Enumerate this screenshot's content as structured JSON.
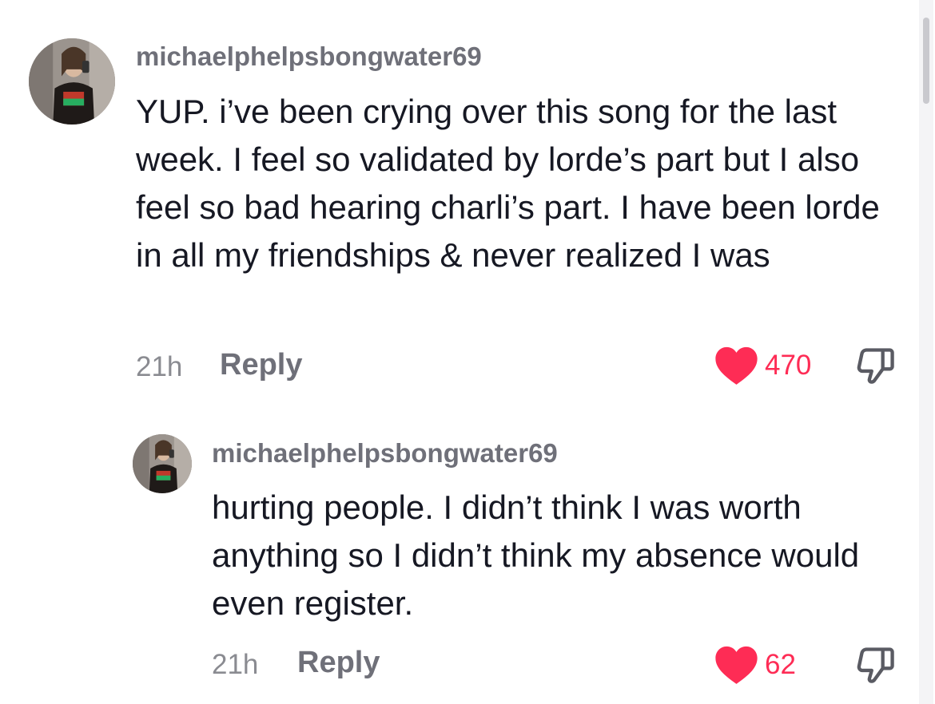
{
  "comments": [
    {
      "username": "michaelphelpsbongwater69",
      "text": "YUP. i’ve been crying over this song for the last week. I feel so validated by lorde’s part but I also feel so bad hearing charli’s part. I have been lorde in all my friendships & never realized I was",
      "time": "21h",
      "reply_label": "Reply",
      "likes": "470",
      "liked": true
    },
    {
      "username": "michaelphelpsbongwater69",
      "text": "hurting people. I didn’t think I was worth anything so I didn’t think my absence would even register.",
      "time": "21h",
      "reply_label": "Reply",
      "likes": "62",
      "liked": true
    }
  ],
  "colors": {
    "like_accent": "#fe2c55",
    "username": "#6f7079",
    "text": "#161823"
  },
  "icons": {
    "like": "heart-icon",
    "dislike": "thumbs-down-icon"
  }
}
